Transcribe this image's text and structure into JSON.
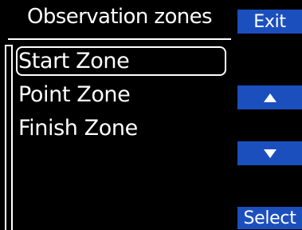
{
  "header": {
    "title": "Observation zones"
  },
  "zones": {
    "items": [
      {
        "label": "Start Zone",
        "selected": true
      },
      {
        "label": "Point Zone",
        "selected": false
      },
      {
        "label": "Finish Zone",
        "selected": false
      }
    ]
  },
  "buttons": {
    "exit_label": "Exit",
    "up_icon": "arrow-up",
    "down_icon": "arrow-down",
    "select_label": "Select"
  },
  "colors": {
    "background": "#000000",
    "button": "#1c4fbe",
    "text": "#ffffff"
  }
}
